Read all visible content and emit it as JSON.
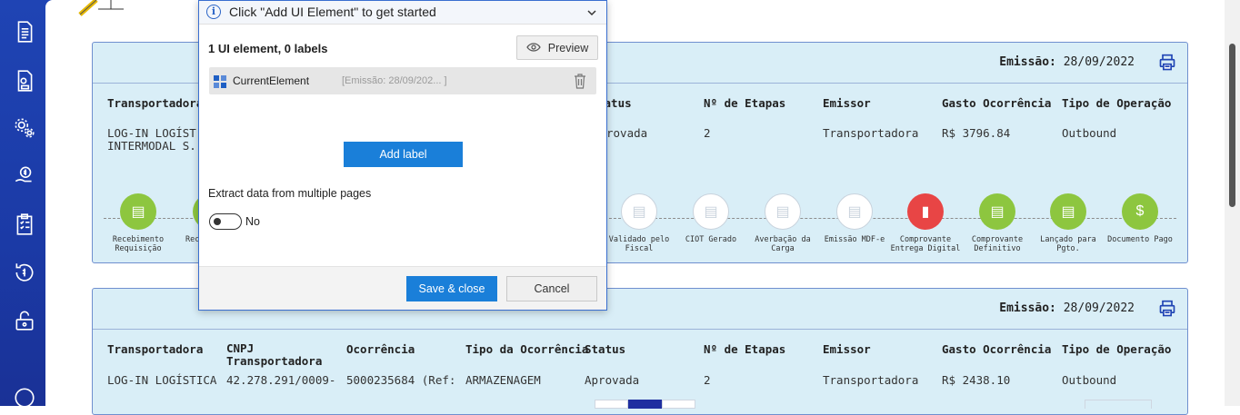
{
  "sidebar": {
    "icons": [
      "document-icon",
      "file-settings-icon",
      "gears-icon",
      "money-hand-icon",
      "checklist-icon",
      "refund-icon",
      "lock-icon",
      "circle-icon"
    ]
  },
  "dialog": {
    "hint": "Click \"Add UI Element\" to get started",
    "count": "1 UI element, 0 labels",
    "preview_label": "Preview",
    "element_name": "CurrentElement",
    "element_selector": "[Emissão: 28/09/202... ]",
    "add_label": "Add label",
    "extract_label": "Extract data from multiple pages",
    "toggle_text": "No",
    "toggle_on": false,
    "save_label": "Save & close",
    "cancel_label": "Cancel"
  },
  "cards": [
    {
      "emissao_label": "Emissão:",
      "emissao_date": "28/09/2022",
      "headers": {
        "transportadora": "Transportadora",
        "status": "tatus",
        "etapas": "Nº de Etapas",
        "emissor": "Emissor",
        "gasto": "Gasto Ocorrência",
        "operacao": "Tipo de Operação"
      },
      "values": {
        "transportadora_1": "LOG-IN LOGÍST",
        "transportadora_2": "INTERMODAL S.",
        "status": "rovada",
        "etapas": "2",
        "emissor": "Transportadora",
        "gasto": "R$ 3796.84",
        "operacao": "Outbound"
      },
      "steps": [
        {
          "label": "Recebimento Requisição",
          "state": "green"
        },
        {
          "label": "Rec",
          "state": "green"
        },
        {
          "label": "Validado pelo Fiscal",
          "state": "gray"
        },
        {
          "label": "CIOT Gerado",
          "state": "gray"
        },
        {
          "label": "Averbação da Carga",
          "state": "gray"
        },
        {
          "label": "Emissão MDF-e",
          "state": "gray"
        },
        {
          "label": "Comprovante Entrega Digital",
          "state": "red"
        },
        {
          "label": "Comprovante Definitivo",
          "state": "green"
        },
        {
          "label": "Lançado para Pgto.",
          "state": "green"
        },
        {
          "label": "Documento Pago",
          "state": "green"
        }
      ]
    },
    {
      "emissao_label": "Emissão:",
      "emissao_date": "28/09/2022",
      "headers": {
        "transportadora": "Transportadora",
        "cnpj_1": "CNPJ",
        "cnpj_2": "Transportadora",
        "ocorrencia": "Ocorrência",
        "tipo_ocorrencia": "Tipo da Ocorrência",
        "status": "Status",
        "etapas": "Nº de Etapas",
        "emissor": "Emissor",
        "gasto": "Gasto Ocorrência",
        "operacao": "Tipo de Operação"
      },
      "values": {
        "transportadora": "LOG-IN LOGÍSTICA",
        "cnpj": "42.278.291/0009-",
        "ocorrencia": "5000235684 (Ref:",
        "tipo_ocorrencia": "ARMAZENAGEM",
        "status": "Aprovada",
        "etapas": "2",
        "emissor": "Transportadora",
        "gasto": "R$ 2438.10",
        "operacao": "Outbound"
      }
    }
  ],
  "colors": {
    "sidebar": "#1f44b4",
    "card_bg": "#d9eef7",
    "primary_button": "#1a7fd9",
    "step_green": "#8dc63f",
    "step_red": "#e84545"
  }
}
